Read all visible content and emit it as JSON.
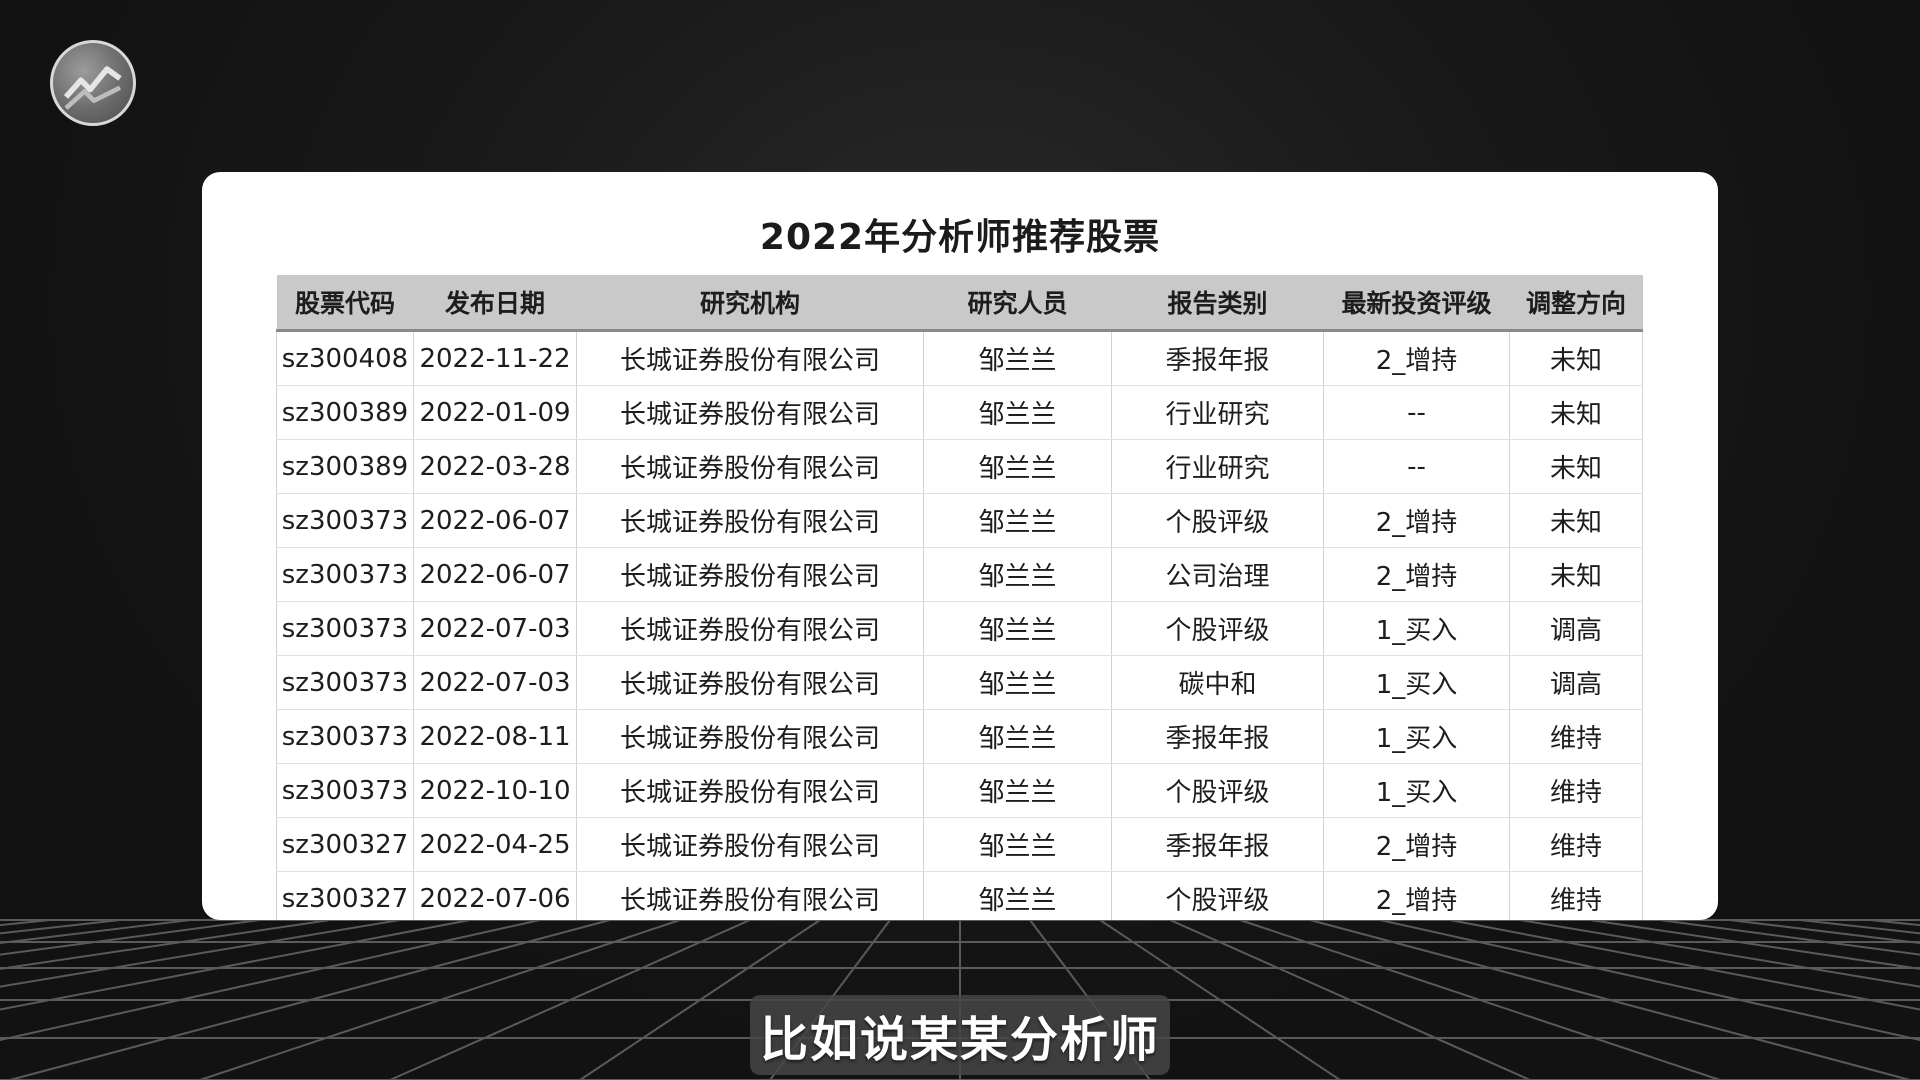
{
  "title": "2022年分析师推荐股票",
  "columns": [
    "股票代码",
    "发布日期",
    "研究机构",
    "研究人员",
    "报告类别",
    "最新投资评级",
    "调整方向"
  ],
  "rows": [
    [
      "sz300408",
      "2022-11-22",
      "长城证券股份有限公司",
      "邹兰兰",
      "季报年报",
      "2_增持",
      "未知"
    ],
    [
      "sz300389",
      "2022-01-09",
      "长城证券股份有限公司",
      "邹兰兰",
      "行业研究",
      "--",
      "未知"
    ],
    [
      "sz300389",
      "2022-03-28",
      "长城证券股份有限公司",
      "邹兰兰",
      "行业研究",
      "--",
      "未知"
    ],
    [
      "sz300373",
      "2022-06-07",
      "长城证券股份有限公司",
      "邹兰兰",
      "个股评级",
      "2_增持",
      "未知"
    ],
    [
      "sz300373",
      "2022-06-07",
      "长城证券股份有限公司",
      "邹兰兰",
      "公司治理",
      "2_增持",
      "未知"
    ],
    [
      "sz300373",
      "2022-07-03",
      "长城证券股份有限公司",
      "邹兰兰",
      "个股评级",
      "1_买入",
      "调高"
    ],
    [
      "sz300373",
      "2022-07-03",
      "长城证券股份有限公司",
      "邹兰兰",
      "碳中和",
      "1_买入",
      "调高"
    ],
    [
      "sz300373",
      "2022-08-11",
      "长城证券股份有限公司",
      "邹兰兰",
      "季报年报",
      "1_买入",
      "维持"
    ],
    [
      "sz300373",
      "2022-10-10",
      "长城证券股份有限公司",
      "邹兰兰",
      "个股评级",
      "1_买入",
      "维持"
    ],
    [
      "sz300327",
      "2022-04-25",
      "长城证券股份有限公司",
      "邹兰兰",
      "季报年报",
      "2_增持",
      "维持"
    ],
    [
      "sz300327",
      "2022-07-06",
      "长城证券股份有限公司",
      "邹兰兰",
      "个股评级",
      "2_增持",
      "维持"
    ]
  ],
  "subtitle": "比如说某某分析师",
  "logo_icon": "channel-logo-icon",
  "colors": {
    "background": "#141414",
    "card": "#ffffff",
    "header_bg": "#c9c9c9",
    "text": "#1d1d1d"
  }
}
